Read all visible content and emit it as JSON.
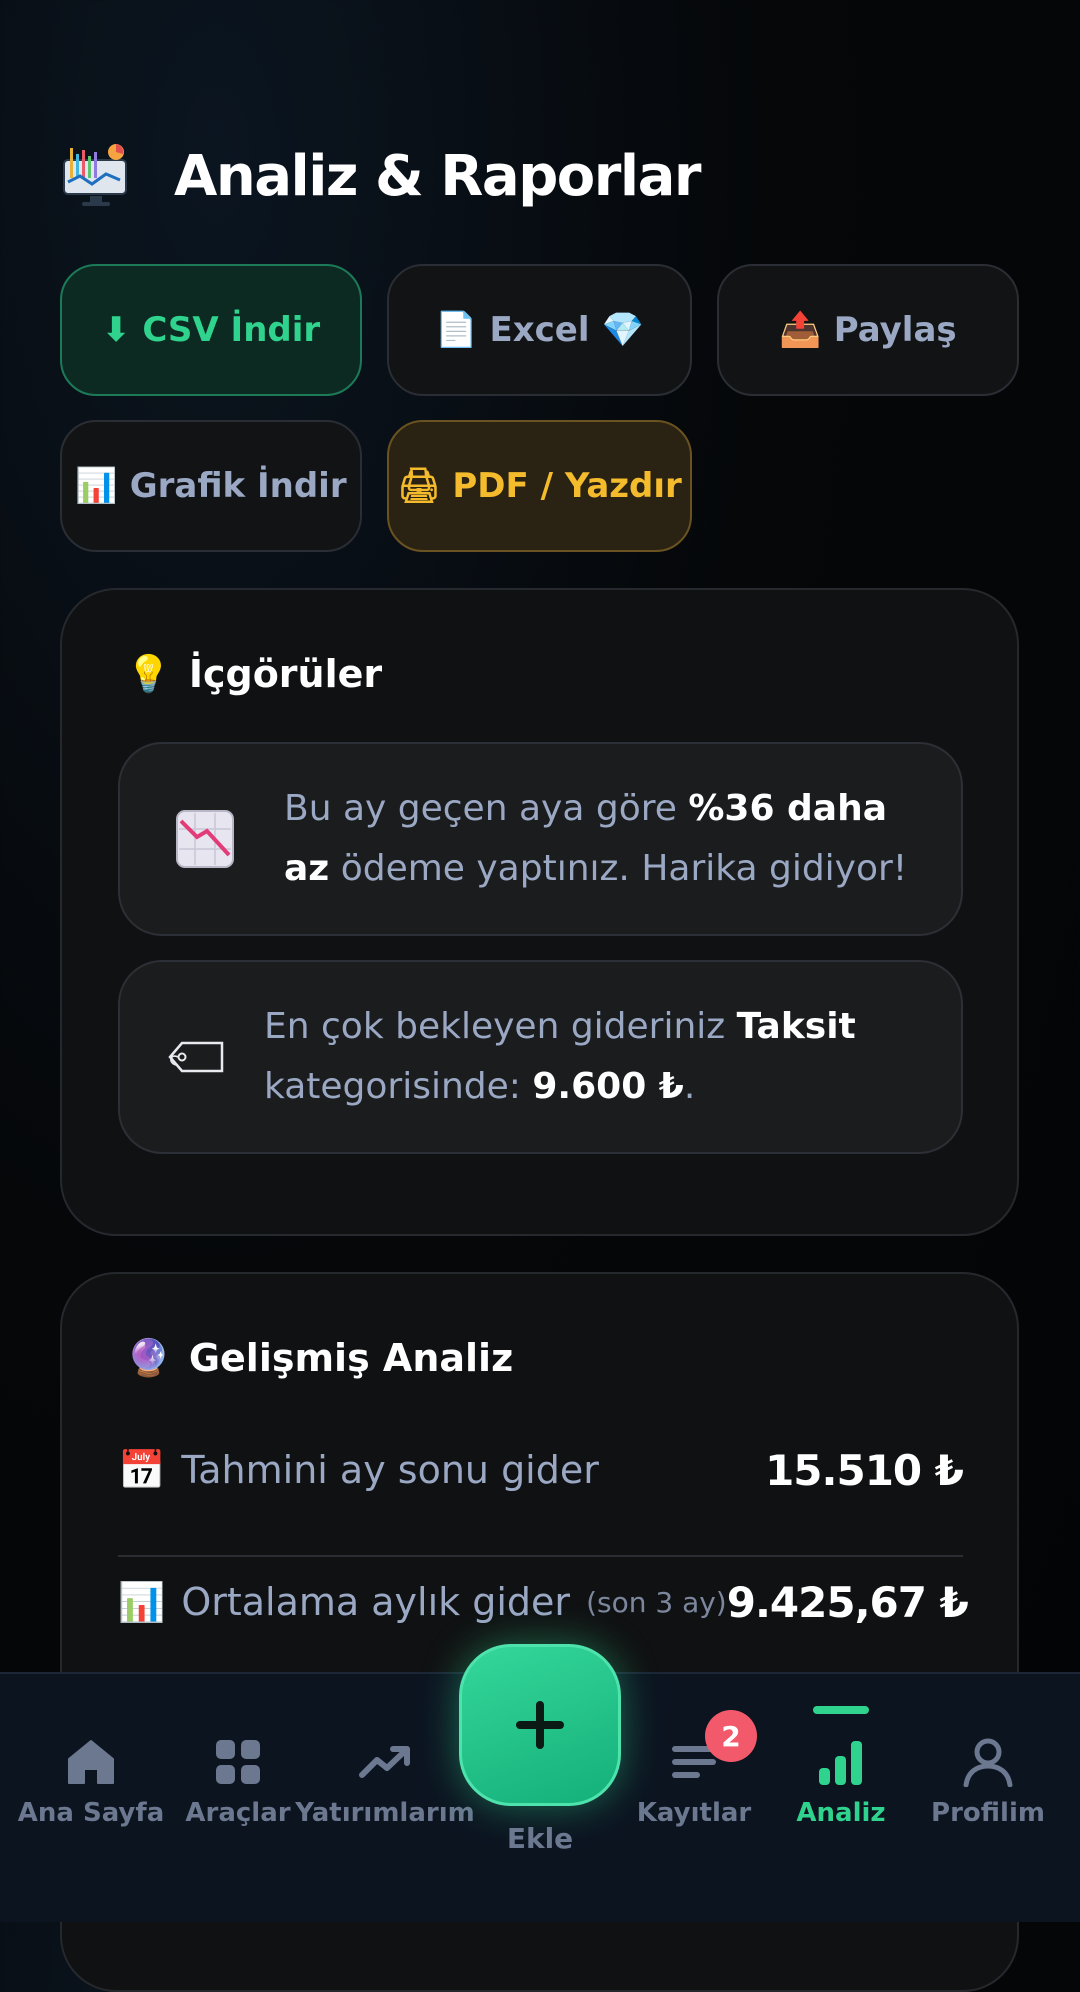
{
  "header": {
    "title": "Analiz & Raporlar",
    "logo_icon": "analytics-monitor-icon"
  },
  "actions": {
    "csv": {
      "icon": "⬇",
      "label": "CSV İndir"
    },
    "excel": {
      "icon": "📄",
      "label": "Excel",
      "badge_icon": "💎"
    },
    "share": {
      "icon": "📤",
      "label": "Paylaş"
    },
    "graph": {
      "icon": "📊",
      "label": "Grafik İndir"
    },
    "pdf": {
      "icon": "🖨",
      "label": "PDF / Yazdır"
    }
  },
  "insights": {
    "title": "İçgörüler",
    "title_icon": "💡",
    "items": [
      {
        "icon": "chart-decreasing-icon",
        "pre": "Bu ay geçen aya göre ",
        "highlight": "%36 daha az",
        "post": " ödeme yaptınız. Harika gidiyor!"
      },
      {
        "icon": "price-tag-icon",
        "pre": "En çok bekleyen gideriniz ",
        "highlight": "Taksit",
        "mid": " kategorisinde: ",
        "amount": "9.600 ₺",
        "post": "."
      }
    ]
  },
  "advanced": {
    "title": "Gelişmiş Analiz",
    "title_icon": "🔮",
    "rows": [
      {
        "icon": "📅",
        "label": "Tahmini ay sonu gider",
        "note": "",
        "value": "15.510 ₺"
      },
      {
        "icon": "📊",
        "label": "Ortalama aylık gider",
        "note": "(son 3 ay)",
        "value": "9.425,67 ₺"
      }
    ]
  },
  "nav": {
    "items": [
      {
        "label": "Ana Sayfa",
        "icon": "home-icon"
      },
      {
        "label": "Araçlar",
        "icon": "grid-icon"
      },
      {
        "label": "Yatırımlarım",
        "icon": "trending-up-icon"
      },
      {
        "label": "Kayıtlar",
        "icon": "list-icon",
        "badge": "2"
      },
      {
        "label": "Analiz",
        "icon": "bar-chart-icon",
        "active": true
      },
      {
        "label": "Profilim",
        "icon": "user-icon"
      }
    ],
    "fab_label": "Ekle",
    "fab_icon": "plus-icon"
  },
  "colors": {
    "accent": "#2fd38d",
    "warning": "#f4bb2c",
    "badge": "#f25a6c",
    "muted": "#9aa8c4"
  }
}
